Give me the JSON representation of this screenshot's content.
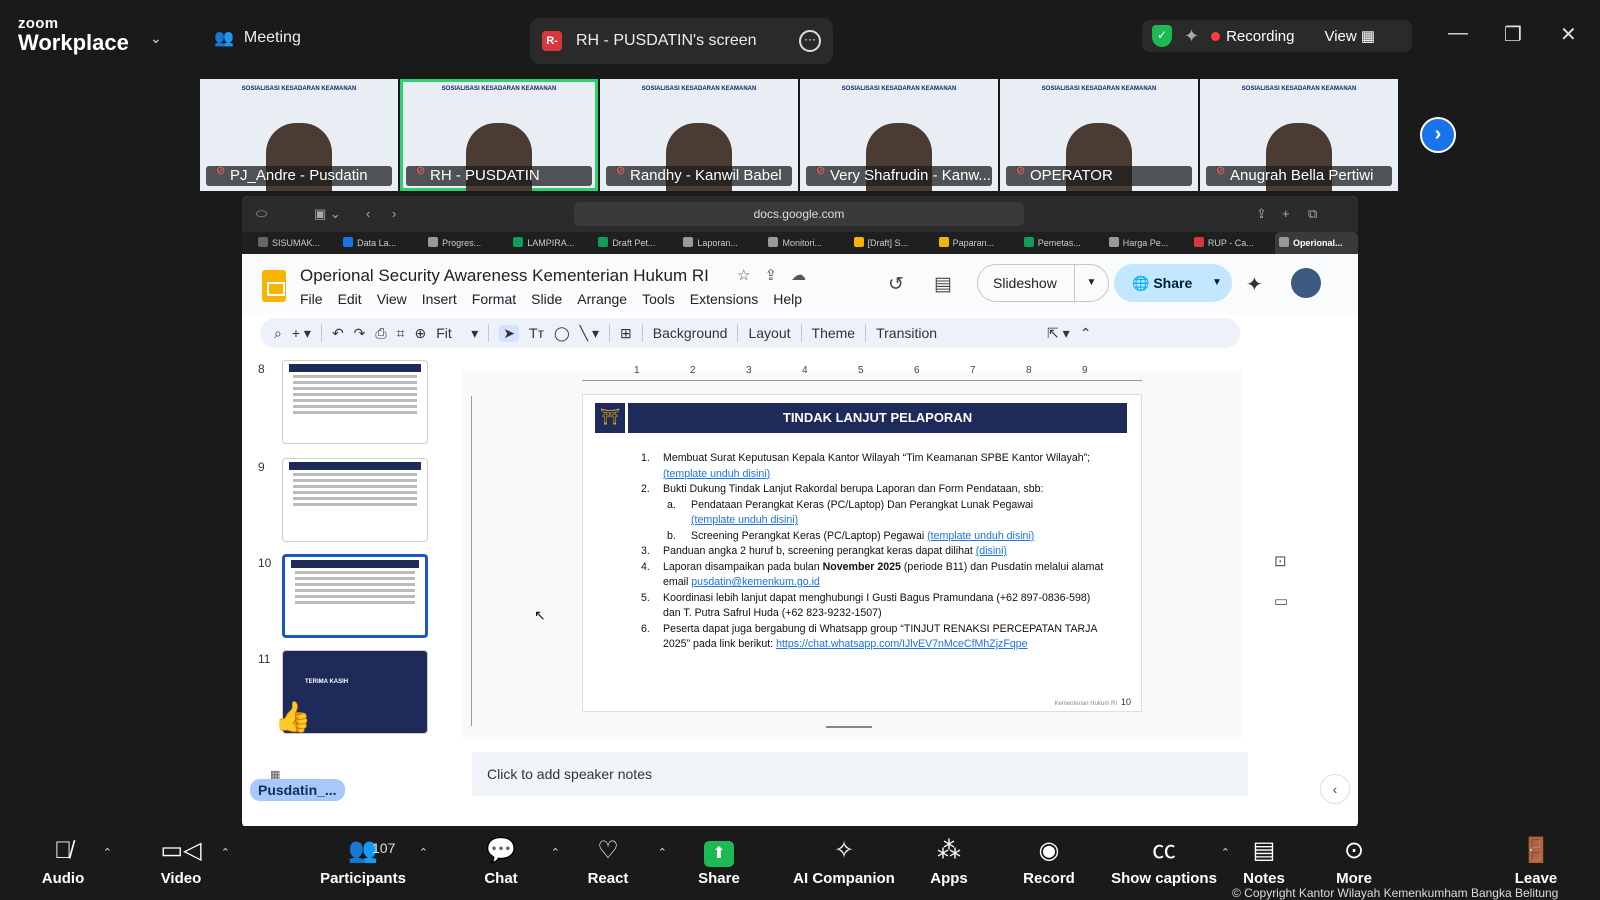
{
  "app": {
    "brand_top": "zoom",
    "brand_bottom": "Workplace"
  },
  "topbar": {
    "meeting_label": "Meeting",
    "share_badge": "R-",
    "shared_screen_label": "RH - PUSDATIN's screen",
    "recording_label": "Recording",
    "view_label": "View"
  },
  "participants_strip": [
    {
      "name": "PJ_Andre - Pusdatin",
      "active": false
    },
    {
      "name": "RH - PUSDATIN",
      "active": true
    },
    {
      "name": "Randhy - Kanwil Babel",
      "active": false
    },
    {
      "name": "Very Shafrudin - Kanw...",
      "active": false
    },
    {
      "name": "OPERATOR",
      "active": false
    },
    {
      "name": "Anugrah Bella Pertiwi",
      "active": false
    }
  ],
  "tile_banner": "SOSIALISASI KESADARAN KEAMANAN",
  "browser": {
    "url": "docs.google.com",
    "tabs": [
      {
        "label": "SISUMAK...",
        "color": "#666"
      },
      {
        "label": "Data La...",
        "color": "#1a73e8"
      },
      {
        "label": "Progres...",
        "color": "#999"
      },
      {
        "label": "LAMPIRA...",
        "color": "#0f9d58"
      },
      {
        "label": "Draft Pet...",
        "color": "#0f9d58"
      },
      {
        "label": "Laporan...",
        "color": "#999"
      },
      {
        "label": "Monitori...",
        "color": "#999"
      },
      {
        "label": "[Draft] S...",
        "color": "#f4b400"
      },
      {
        "label": "Paparan...",
        "color": "#f4b400"
      },
      {
        "label": "Pemetas...",
        "color": "#0f9d58"
      },
      {
        "label": "Harga Pe...",
        "color": "#999"
      },
      {
        "label": "RUP - Ca...",
        "color": "#d9363e"
      },
      {
        "label": "Operional...",
        "color": "#999",
        "active": true
      }
    ]
  },
  "docs": {
    "title": "Operional Security Awareness Kementerian Hukum RI",
    "menu": [
      "File",
      "Edit",
      "View",
      "Insert",
      "Format",
      "Slide",
      "Arrange",
      "Tools",
      "Extensions",
      "Help"
    ],
    "slideshow_label": "Slideshow",
    "share_label": "Share",
    "toolbar": {
      "zoom": "Fit",
      "background": "Background",
      "layout": "Layout",
      "theme": "Theme",
      "transition": "Transition"
    },
    "ruler_numbers": [
      "1",
      "2",
      "3",
      "4",
      "5",
      "6",
      "7",
      "8",
      "9"
    ],
    "thumbnails": [
      {
        "num": "8",
        "current": false
      },
      {
        "num": "9",
        "current": false
      },
      {
        "num": "10",
        "current": true
      },
      {
        "num": "11",
        "current": false
      }
    ],
    "thumb11_title": "TERIMA KASIH",
    "speaker_notes_placeholder": "Click to add speaker notes",
    "presenter_pill": "Pusdatin_..."
  },
  "slide": {
    "title": "TINDAK LANJUT PELAPORAN",
    "items": {
      "i1_num": "1.",
      "i1_text": "Membuat Surat Keputusan Kepala Kantor Wilayah “Tim Keamanan SPBE Kantor Wilayah”;",
      "i1_link": "(template unduh disini)",
      "i2_num": "2.",
      "i2_text": "Bukti Dukung Tindak Lanjut Rakordal berupa Laporan dan Form Pendataan, sbb:",
      "i2a_num": "a.",
      "i2a_text": "Pendataan Perangkat Keras (PC/Laptop) Dan  Perangkat Lunak Pegawai",
      "i2a_link": "(template unduh disini)",
      "i2b_num": "b.",
      "i2b_text": "Screening Perangkat Keras (PC/Laptop) Pegawai",
      "i2b_link": "(template unduh disini)",
      "i3_num": "3.",
      "i3_text": "Panduan angka 2 huruf b, screening perangkat keras dapat dilihat",
      "i3_link": "(disini)",
      "i4_num": "4.",
      "i4_text_a": "Laporan disampaikan pada bulan",
      "i4_bold": "November 2025",
      "i4_text_b": "(periode B11) dan Pusdatin melalui alamat email",
      "i4_link": "pusdatin@kemenkum.go.id",
      "i5_num": "5.",
      "i5_text": "Koordinasi lebih lanjut dapat menghubungi I Gusti Bagus Pramundana (+62 897-0836-598) dan T. Putra Safrul Huda (+62 823-9232-1507)",
      "i6_num": "6.",
      "i6_text": "Peserta dapat juga bergabung di Whatsapp group “TINJUT RENAKSI PERCEPATAN TARJA 2025” pada link berikut:",
      "i6_link": "https://chat.whatsapp.com/IJlvEV7nMceCfMhZjzFqpe"
    },
    "footer_org": "Kementerian Hukum RI",
    "footer_page": "10"
  },
  "controls": {
    "audio": "Audio",
    "video": "Video",
    "participants": "Participants",
    "participants_count": "107",
    "chat": "Chat",
    "react": "React",
    "share": "Share",
    "ai_companion": "AI Companion",
    "apps": "Apps",
    "record": "Record",
    "show_captions": "Show captions",
    "notes": "Notes",
    "more": "More",
    "leave": "Leave"
  },
  "copyright": "© Copyright Kantor Wilayah Kemenkumham Bangka Belitung",
  "colors": {
    "accent_green": "#1eb854",
    "zoom_blue": "#1a73e8",
    "recording_red": "#ff3b3b",
    "slide_navy": "#1e2a5a"
  }
}
